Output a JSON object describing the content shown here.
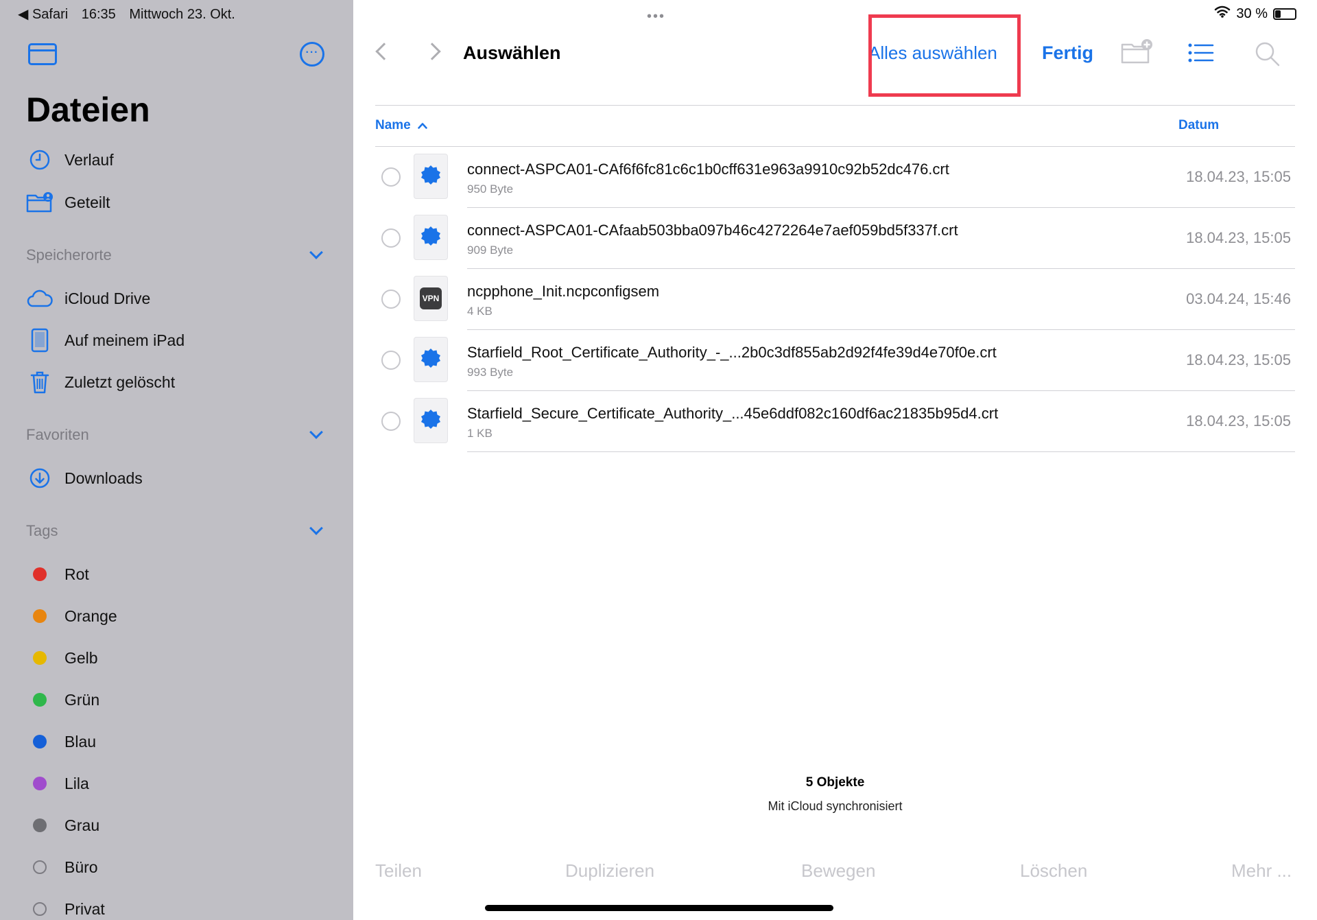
{
  "status_bar": {
    "back_app": "◀ Safari",
    "time": "16:35",
    "date": "Mittwoch 23. Okt.",
    "battery_text": "30 %",
    "battery_level": 0.3
  },
  "sidebar": {
    "title": "Dateien",
    "items": [
      {
        "label": "Verlauf",
        "icon": "clock-icon"
      },
      {
        "label": "Geteilt",
        "icon": "shared-folder-icon"
      }
    ],
    "sections": {
      "locations": {
        "title": "Speicherorte",
        "items": [
          {
            "label": "iCloud Drive",
            "icon": "cloud-icon"
          },
          {
            "label": "Auf meinem iPad",
            "icon": "ipad-icon"
          },
          {
            "label": "Zuletzt gelöscht",
            "icon": "trash-icon"
          }
        ]
      },
      "favorites": {
        "title": "Favoriten",
        "items": [
          {
            "label": "Downloads",
            "icon": "download-icon"
          }
        ]
      },
      "tags": {
        "title": "Tags",
        "items": [
          {
            "label": "Rot",
            "color": "#e0302a"
          },
          {
            "label": "Orange",
            "color": "#e8850f"
          },
          {
            "label": "Gelb",
            "color": "#e6b800"
          },
          {
            "label": "Grün",
            "color": "#2fb74b"
          },
          {
            "label": "Blau",
            "color": "#1560d8"
          },
          {
            "label": "Lila",
            "color": "#a04ccd"
          },
          {
            "label": "Grau",
            "color": "#6e6e73"
          },
          {
            "label": "Büro",
            "color": ""
          },
          {
            "label": "Privat",
            "color": ""
          }
        ]
      }
    }
  },
  "header": {
    "title": "Auswählen",
    "select_all": "Alles auswählen",
    "done": "Fertig"
  },
  "columns": {
    "name": "Name",
    "date": "Datum"
  },
  "files": [
    {
      "name": "connect-ASPCA01-CAf6f6fc81c6c1b0cff631e963a9910c92b52dc476.crt",
      "size": "950 Byte",
      "date": "18.04.23, 15:05",
      "icon": "certificate-icon"
    },
    {
      "name": "connect-ASPCA01-CAfaab503bba097b46c4272264e7aef059bd5f337f.crt",
      "size": "909 Byte",
      "date": "18.04.23, 15:05",
      "icon": "certificate-icon"
    },
    {
      "name": "ncpphone_Init.ncpconfigsem",
      "size": "4 KB",
      "date": "03.04.24, 15:46",
      "icon": "vpn-icon"
    },
    {
      "name": "Starfield_Root_Certificate_Authority_-_...2b0c3df855ab2d92f4fe39d4e70f0e.crt",
      "size": "993 Byte",
      "date": "18.04.23, 15:05",
      "icon": "certificate-icon"
    },
    {
      "name": "Starfield_Secure_Certificate_Authority_...45e6ddf082c160df6ac21835b95d4.crt",
      "size": "1 KB",
      "date": "18.04.23, 15:05",
      "icon": "certificate-icon"
    }
  ],
  "vpn_badge": "VPN",
  "footer": {
    "count": "5 Objekte",
    "sync": "Mit iCloud synchronisiert"
  },
  "toolbar": {
    "share": "Teilen",
    "duplicate": "Duplizieren",
    "move": "Bewegen",
    "delete": "Löschen",
    "more": "Mehr ..."
  },
  "colors": {
    "accent": "#1a73e8",
    "highlight": "#ef3b4f",
    "sidebar_bg": "#c0bfc5"
  }
}
